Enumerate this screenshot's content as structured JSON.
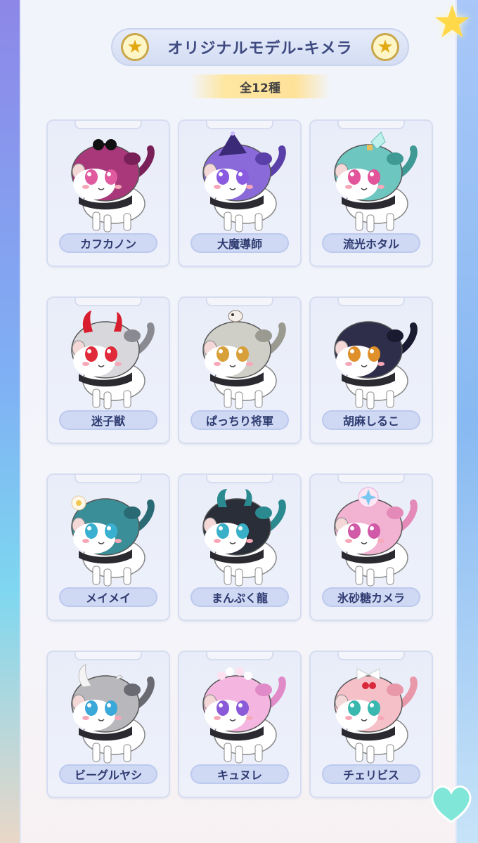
{
  "header": {
    "title": "オリジナルモデル-キメラ",
    "count": "全12種"
  },
  "characters": [
    {
      "name": "カフカノン",
      "head_color": "#a8387a",
      "ear_color": "#7a2058",
      "eye_color": "#e05aa0",
      "accessory": "sunglasses-icon"
    },
    {
      "name": "大魔導師",
      "head_color": "#8a6ad8",
      "ear_color": "#5a3fa8",
      "eye_color": "#8a5ae0",
      "accessory": "wizard-hat-icon"
    },
    {
      "name": "流光ホタル",
      "head_color": "#6ec6c0",
      "ear_color": "#3f9a96",
      "eye_color": "#e2559a",
      "accessory": "firefly-wing-icon"
    },
    {
      "name": "迷子獣",
      "head_color": "#d8d8dc",
      "ear_color": "#8a8a92",
      "eye_color": "#e02a3a",
      "accessory": "red-horns-icon"
    },
    {
      "name": "ぱっちり将軍",
      "head_color": "#cfcfc8",
      "ear_color": "#9a9a90",
      "eye_color": "#d8a03a",
      "accessory": "small-bird-icon"
    },
    {
      "name": "胡麻しるこ",
      "head_color": "#2e2e4a",
      "ear_color": "#1a1a30",
      "eye_color": "#e0902a",
      "accessory": "red-tail-icon"
    },
    {
      "name": "メイメイ",
      "head_color": "#3a8e98",
      "ear_color": "#2a6a74",
      "eye_color": "#3ab0d0",
      "accessory": "flower-icon"
    },
    {
      "name": "まんぷく龍",
      "head_color": "#2a2e38",
      "ear_color": "#2a8a90",
      "eye_color": "#3ab0c8",
      "accessory": "dragon-horns-icon"
    },
    {
      "name": "氷砂糖カメラ",
      "head_color": "#f2b2d2",
      "ear_color": "#e48ab8",
      "eye_color": "#d05aa8",
      "accessory": "crystal-flower-icon"
    },
    {
      "name": "ビーグルヤシ",
      "head_color": "#b8b8bc",
      "ear_color": "#6a6a72",
      "eye_color": "#3aa8d8",
      "accessory": "white-horn-icon"
    },
    {
      "name": "キュヌレ",
      "head_color": "#f4b6e0",
      "ear_color": "#e08ac8",
      "eye_color": "#8a5ad8",
      "accessory": "flower-crown-icon"
    },
    {
      "name": "チェリビス",
      "head_color": "#f6c0c8",
      "ear_color": "#e898a8",
      "eye_color": "#3ab8b0",
      "accessory": "cherry-bow-icon"
    }
  ],
  "decor": {
    "corner_star": "star-icon",
    "corner_heart": "heart-balloon-icon",
    "accent": "#ffd94a"
  }
}
